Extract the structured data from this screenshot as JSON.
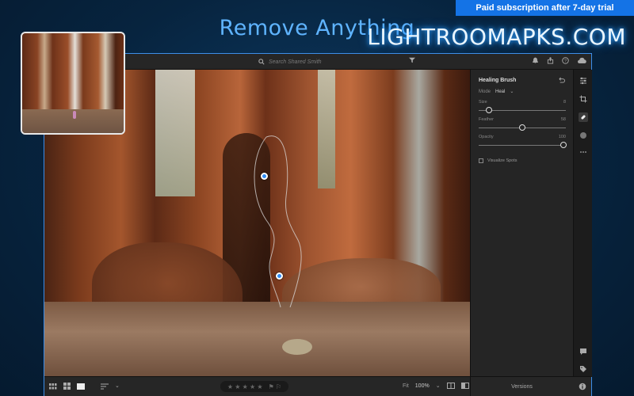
{
  "promo": {
    "title": "Remove Anything",
    "badge": "Paid subscription after 7-day trial",
    "watermark": "LIGHTROOMAPKS.COM"
  },
  "topbar": {
    "search_placeholder": "Search Shared Smith"
  },
  "panel": {
    "title": "Healing Brush",
    "mode_label": "Mode",
    "mode_value": "Heal",
    "sliders": [
      {
        "label": "Size",
        "value": "8",
        "fraction": 0.12
      },
      {
        "label": "Feather",
        "value": "58",
        "fraction": 0.5
      },
      {
        "label": "Opacity",
        "value": "100",
        "fraction": 0.97
      }
    ],
    "visualize_spots": "Visualize Spots"
  },
  "bottombar": {
    "stars": "★ ★ ★ ★ ★",
    "flags": "⚑ ⚐",
    "fit": "Fit",
    "zoom": "100%",
    "versions": "Versions"
  },
  "colors": {
    "accent": "#1473e6",
    "title": "#5fb4ff",
    "app_border": "#3d8ee8",
    "healing_pin": "#2f8cf5"
  }
}
